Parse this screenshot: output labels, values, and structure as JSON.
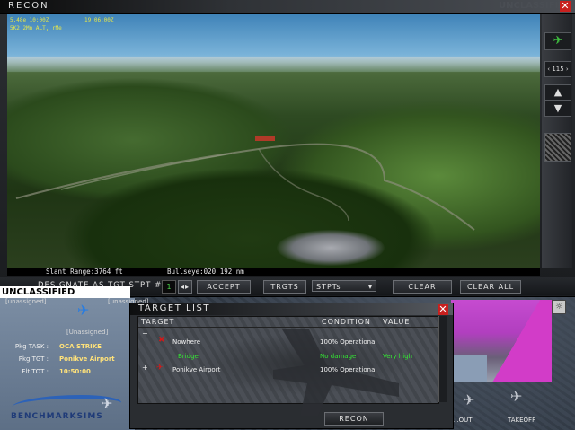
{
  "recon": {
    "title": "RECON",
    "classification_top": "UNCLASSIFIED",
    "hud_lines": [
      "5.48e 10:00Z",
      "19 06:00Z",
      "5K2 2Mn ALT, rMe"
    ],
    "status": {
      "slant_range": "Slant Range:3764 ft",
      "bullseye": "Bullseye:020   192 nm"
    },
    "side_panel": {
      "heading_value": "115"
    },
    "toolbar": {
      "designate_label": "DESIGNATE AS TGT STPT #",
      "stpt_number": "1",
      "accept_label": "ACCEPT",
      "targets_label": "TRGTS",
      "stpts_label": "STPTs",
      "clear_label": "CLEAR",
      "clear_all_label": "CLEAR ALL"
    }
  },
  "briefing": {
    "classification": "UNCLASSIFIED",
    "unassigned_top_left": "[unassigned]",
    "unassigned_top_mid": "[unassigned]",
    "unassigned_center": "[Unassigned]",
    "pkg_task_label": "Pkg TASK :",
    "pkg_task_value": "OCA STRIKE",
    "pkg_tgt_label": "Pkg TGT :",
    "pkg_tgt_value": "Ponikve Airport",
    "flt_tot_label": "Flt TOT :",
    "flt_tot_value": "10:50:00",
    "brand": "BENCHMARKSIMS",
    "bottom_right_labels": [
      "...OUT",
      "TAKEOFF"
    ]
  },
  "target_list": {
    "title": "TARGET LIST",
    "columns": [
      "TARGET",
      "CONDITION",
      "VALUE"
    ],
    "rows": [
      {
        "expander": "−",
        "name": "Nowhere",
        "condition": "100% Operational",
        "value": "",
        "color": "white"
      },
      {
        "expander": "",
        "name": "Bridge",
        "condition": "No damage",
        "value": "Very high",
        "color": "green"
      },
      {
        "expander": "+",
        "name": "Ponikve Airport",
        "condition": "100% Operational",
        "value": "",
        "color": "white"
      }
    ],
    "recon_button": "RECON"
  },
  "colors": {
    "close_red": "#c8201e",
    "highlight_green": "#33e633",
    "hud_yellow": "#e6e64a",
    "pkg_value_yellow": "#ffe27a"
  }
}
